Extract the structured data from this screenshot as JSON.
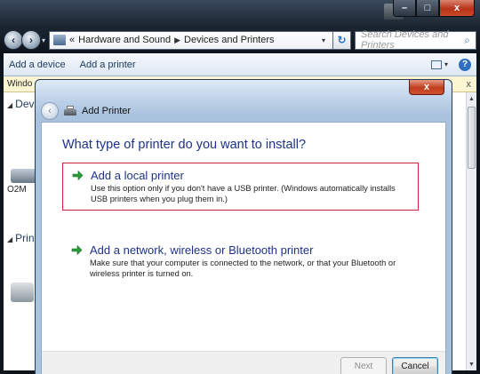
{
  "explorer": {
    "breadcrumb": {
      "chevron": "«",
      "parts": [
        "Hardware and Sound",
        "Devices and Printers"
      ]
    },
    "search_placeholder": "Search Devices and Printers",
    "toolbar": {
      "add_device": "Add a device",
      "add_printer": "Add a printer"
    },
    "infobar_text": "Windo",
    "groups": [
      {
        "label": "Dev"
      },
      {
        "label": "Prin"
      }
    ],
    "device_label": "O2M",
    "window_controls": {
      "minimize": "–",
      "maximize": "□",
      "close": "x"
    }
  },
  "dialog": {
    "title": "Add Printer",
    "close_label": "x",
    "question": "What type of printer do you want to install?",
    "options": [
      {
        "title": "Add a local printer",
        "description": "Use this option only if you don't have a USB printer. (Windows automatically installs USB printers when you plug them in.)",
        "selected": true
      },
      {
        "title": "Add a network, wireless or Bluetooth printer",
        "description": "Make sure that your computer is connected to the network, or that your Bluetooth or wireless printer is turned on.",
        "selected": false
      }
    ],
    "buttons": {
      "next": "Next",
      "cancel": "Cancel"
    }
  },
  "colors": {
    "heading_blue": "#1e3287",
    "selection_red": "#c9283a",
    "arrow_green": "#2a9d3a"
  }
}
